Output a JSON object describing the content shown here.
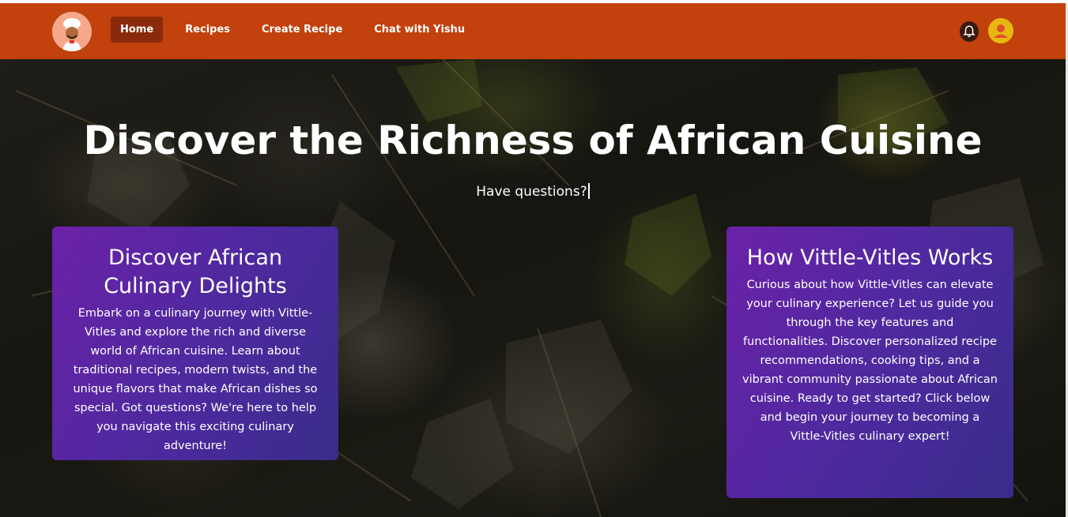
{
  "nav": {
    "items": [
      {
        "label": "Home",
        "active": true
      },
      {
        "label": "Recipes",
        "active": false
      },
      {
        "label": "Create Recipe",
        "active": false
      },
      {
        "label": "Chat with Yishu",
        "active": false
      }
    ],
    "logo_icon": "chef-icon",
    "bell_icon": "bell-icon",
    "avatar_icon": "user-avatar-icon"
  },
  "hero": {
    "title": "Discover the Richness of African Cuisine",
    "subtitle": "Have questions?"
  },
  "cards": [
    {
      "title": "Discover African Culinary Delights",
      "body": "Embark on a culinary journey with Vittle-Vitles and explore the rich and diverse world of African cuisine. Learn about traditional recipes, modern twists, and the unique flavors that make African dishes so special. Got questions? We're here to help you navigate this exciting culinary adventure!"
    },
    {
      "title": "How Vittle-Vitles Works",
      "body": "Curious about how Vittle-Vitles can elevate your culinary experience? Let us guide you through the key features and functionalities. Discover personalized recipe recommendations, cooking tips, and a vibrant community passionate about African cuisine. Ready to get started? Click below and begin your journey to becoming a Vittle-Vitles culinary expert!"
    }
  ],
  "colors": {
    "navbar": "#c2410c",
    "nav_active": "#8a2a0a",
    "card_start": "#6b21a8",
    "card_end": "#3a2c8a",
    "avatar": "#e8b70f"
  }
}
